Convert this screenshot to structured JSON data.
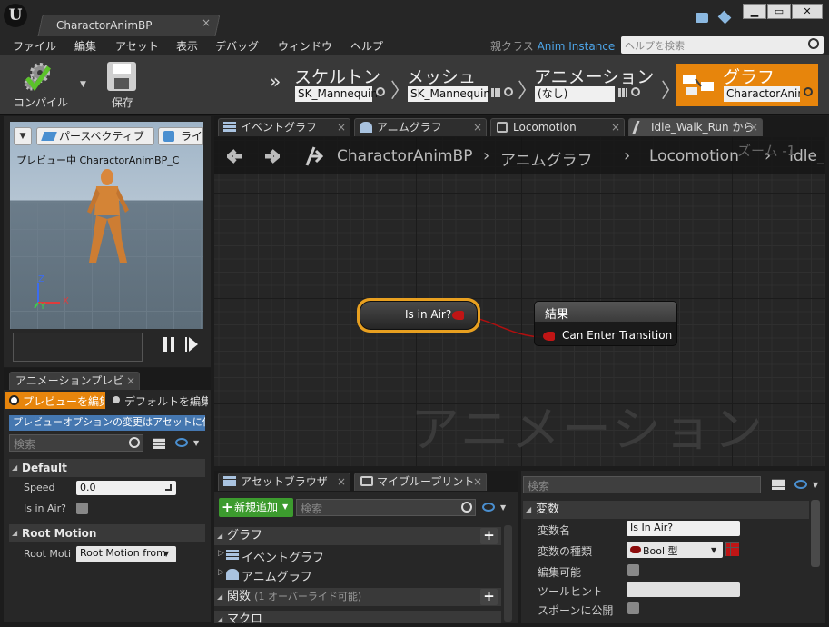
{
  "window": {
    "tab_title": "CharactorAnimBP",
    "tab_close": "×",
    "minimize": "▁",
    "maximize": "▭",
    "close": "✕"
  },
  "menu": {
    "items": [
      "ファイル",
      "編集",
      "アセット",
      "表示",
      "デバッグ",
      "ウィンドウ",
      "ヘルプ"
    ],
    "parent_class_label": "親クラス",
    "parent_class_value": "Anim Instance",
    "help_search_placeholder": "ヘルプを検索"
  },
  "toolbar": {
    "compile": "コンパイル",
    "save": "保存",
    "overflow": "»",
    "breadcrumbs": [
      {
        "title": "スケルトン",
        "value": "SK_Mannequin"
      },
      {
        "title": "メッシュ",
        "value": "SK_Mannequin"
      },
      {
        "title": "アニメーション",
        "value": "(なし)"
      },
      {
        "title": "グラフ",
        "value": "CharactorAnim"
      }
    ]
  },
  "viewport": {
    "perspective": "パースペクティブ",
    "lit": "ライ",
    "preview_text": "プレビュー中 CharactorAnimBP_C",
    "axis_z": "Z",
    "axis_x": "X",
    "axis_y": "Y"
  },
  "anim_preview": {
    "tab": "アニメーションプレビ",
    "radio_edit": "プレビューを編集",
    "radio_default": "デフォルトを編集",
    "notice": "プレビューオプションの変更はアセットに保存されません",
    "search_placeholder": "検索",
    "section_default": "Default",
    "speed_label": "Speed",
    "speed_value": "0.0",
    "is_in_air_label": "Is in Air?",
    "section_root": "Root Motion",
    "root_label": "Root Motio",
    "root_value": "Root Motion from"
  },
  "graph_tabs": [
    "イベントグラフ",
    "アニムグラフ",
    "Locomotion",
    "Idle_Walk_Run から"
  ],
  "graph_breadcrumb": {
    "items": [
      "CharactorAnimBP",
      "アニムグラフ",
      "Locomotion",
      "Idle_"
    ],
    "zoom": "ズーム -1"
  },
  "graph": {
    "node_input": "Is in Air?",
    "result_title": "結果",
    "result_pin": "Can Enter Transition",
    "watermark": "アニメーション"
  },
  "my_blueprint": {
    "tabs": [
      "アセットブラウザ",
      "マイブループリント"
    ],
    "add_new": "新規追加",
    "search_placeholder": "検索",
    "graph_section": "グラフ",
    "graph_items": [
      "イベントグラフ",
      "アニムグラフ"
    ],
    "functions_section": "関数",
    "functions_note": "(1 オーバーライド可能)",
    "macros_section": "マクロ"
  },
  "details": {
    "search_placeholder": "検索",
    "section": "変数",
    "rows": [
      {
        "label": "変数名",
        "value": "Is In Air?"
      },
      {
        "label": "変数の種類",
        "value": "Bool 型"
      },
      {
        "label": "編集可能",
        "value": ""
      },
      {
        "label": "ツールヒント",
        "value": ""
      },
      {
        "label": "スポーンに公開",
        "value": ""
      }
    ]
  },
  "colors": {
    "accent": "#e7850c",
    "pin_red": "#c01515",
    "link": "#4ea5e8"
  }
}
